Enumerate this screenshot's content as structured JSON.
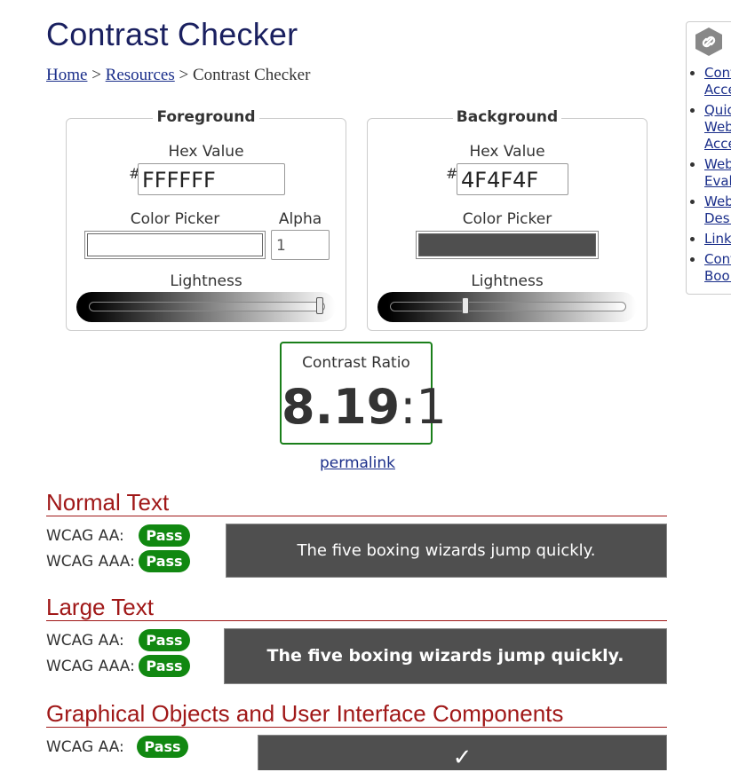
{
  "page": {
    "title": "Contrast Checker"
  },
  "breadcrumb": {
    "home": "Home",
    "sep1": ">",
    "resources": "Resources",
    "sep2": ">",
    "current": "Contrast Checker"
  },
  "foreground": {
    "heading": "Foreground",
    "hex_label": "Hex Value",
    "hash": "#",
    "hex_value": "FFFFFF",
    "picker_label": "Color Picker",
    "alpha_label": "Alpha",
    "alpha_value": "1",
    "lightness_label": "Lightness",
    "lightness": 1.0,
    "color": "#FFFFFF"
  },
  "background": {
    "heading": "Background",
    "hex_label": "Hex Value",
    "hash": "#",
    "hex_value": "4F4F4F",
    "picker_label": "Color Picker",
    "lightness_label": "Lightness",
    "lightness": 0.31,
    "color": "#4F4F4F"
  },
  "ratio": {
    "label": "Contrast Ratio",
    "value": "8.19",
    "suffix": ":1"
  },
  "permalink": "permalink",
  "normal_text": {
    "heading": "Normal Text",
    "aa_label": "WCAG AA:",
    "aa_result": "Pass",
    "aaa_label": "WCAG AAA:",
    "aaa_result": "Pass",
    "sample": "The five boxing wizards jump quickly."
  },
  "large_text": {
    "heading": "Large Text",
    "aa_label": "WCAG AA:",
    "aa_result": "Pass",
    "aaa_label": "WCAG AAA:",
    "aaa_result": "Pass",
    "sample": "The five boxing wizards jump quickly."
  },
  "graphical": {
    "heading": "Graphical Objects and User Interface Components",
    "aa_label": "WCAG AA:",
    "aa_result": "Pass",
    "sample": "✓"
  },
  "sidebar": {
    "icon": "link-icon",
    "items": [
      "Cont\nAcce",
      "Quic\nWeb\nAcce",
      "Web\nEval",
      "Web\nDesi",
      "Link",
      "Cont\nBool"
    ]
  },
  "colors": {
    "pass": "#118811",
    "heading_red": "#A01818",
    "title_blue": "#1A2060",
    "ratio_border": "#1A7F1A"
  }
}
